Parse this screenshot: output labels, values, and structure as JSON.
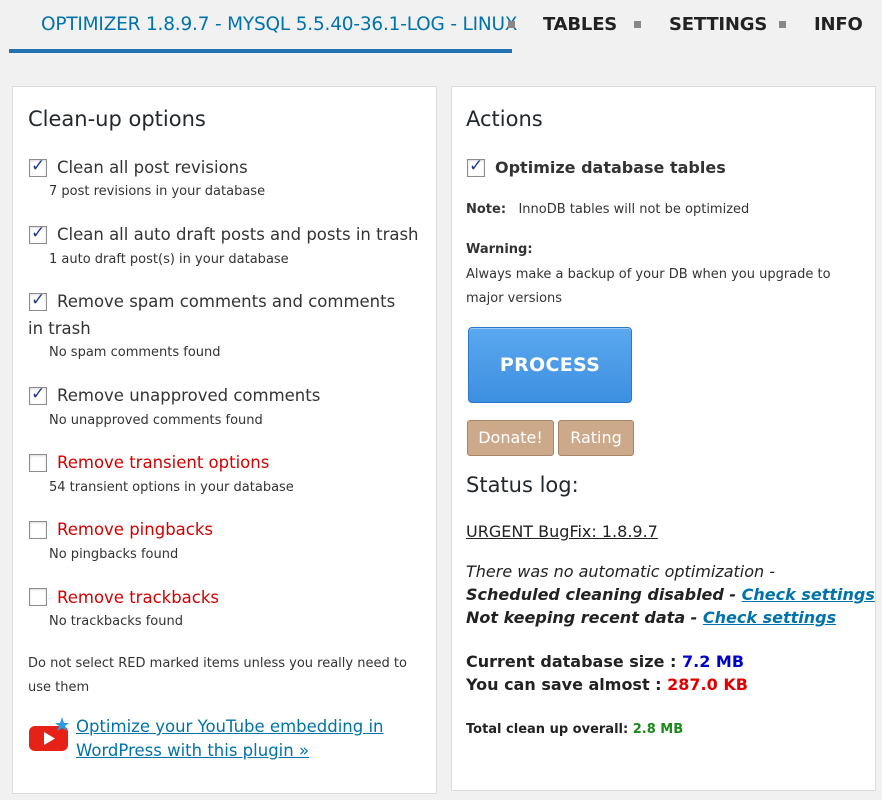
{
  "nav": {
    "title": "OPTIMIZER 1.8.9.7 - MYSQL 5.5.40-36.1-LOG - LINUX",
    "tabs": [
      "TABLES",
      "SETTINGS",
      "INFO"
    ]
  },
  "left": {
    "heading": "Clean-up options",
    "options": [
      {
        "label": "Clean all post revisions",
        "sub": "7 post revisions in your database",
        "checked": true,
        "red": false
      },
      {
        "label": "Clean all auto draft posts and posts in trash",
        "sub": "1 auto draft post(s) in your database",
        "checked": true,
        "red": false
      },
      {
        "label": "Remove spam comments and comments in trash",
        "sub": "No spam comments found",
        "checked": true,
        "red": false
      },
      {
        "label": "Remove unapproved comments",
        "sub": "No unapproved comments found",
        "checked": true,
        "red": false
      },
      {
        "label": "Remove transient options",
        "sub": "54 transient options in your database",
        "checked": false,
        "red": true
      },
      {
        "label": "Remove pingbacks",
        "sub": "No pingbacks found",
        "checked": false,
        "red": true
      },
      {
        "label": "Remove trackbacks",
        "sub": "No trackbacks found",
        "checked": false,
        "red": true
      }
    ],
    "red_note": "Do not select RED marked items unless you really need to use them",
    "youtube_link": "Optimize your YouTube embedding in WordPress with this plugin »"
  },
  "right": {
    "heading": "Actions",
    "optimize_label": "Optimize database tables",
    "note_label": "Note:",
    "note_text": "InnoDB tables will not be optimized",
    "warning_label": "Warning:",
    "warning_text": "Always make a backup of your DB when you upgrade to major versions",
    "process_label": "PROCESS",
    "donate_label": "Donate!",
    "rating_label": "Rating",
    "status_heading": "Status log:",
    "bugfix_link": "URGENT BugFix: 1.8.9.7",
    "no_auto": "There was no automatic optimization -",
    "scheduled": "Scheduled cleaning disabled -",
    "not_keeping": "Not keeping recent data -",
    "check_settings": "Check settings",
    "current_size_label": "Current database size :",
    "current_size_value": "7.2 MB",
    "save_label": "You can save almost :",
    "save_value": "287.0 KB",
    "total_label": "Total clean up overall:",
    "total_value": "2.8 MB"
  },
  "colors": {
    "accent": "#0073aa",
    "red": "#d40000",
    "process": "#4a9be8",
    "tan": "#cca98a"
  }
}
